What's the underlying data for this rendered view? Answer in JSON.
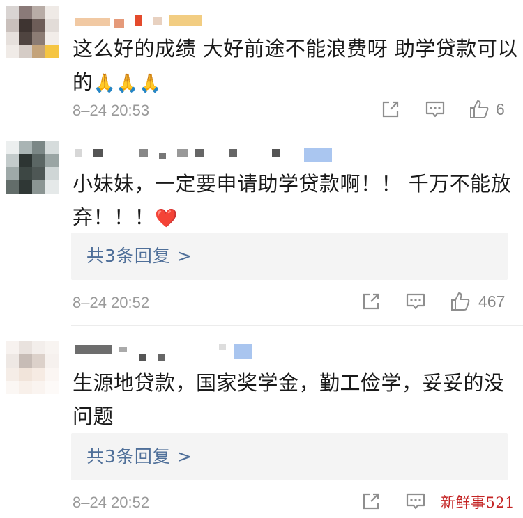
{
  "comments": [
    {
      "text": "这么好的成绩  大好前途不能浪费呀  助学贷款可以的",
      "emoji": "🙏🙏🙏",
      "timestamp": "8–24 20:53",
      "likes": "6",
      "icons": [
        "share-icon",
        "comment-icon",
        "like-icon"
      ]
    },
    {
      "text": "小妹妹，一定要申请助学贷款啊！！  千万不能放弃！！！",
      "emoji": "❤️",
      "replies_label": "共3条回复 >",
      "timestamp": "8–24 20:52",
      "likes": "467",
      "icons": [
        "share-icon",
        "comment-icon",
        "like-icon"
      ]
    },
    {
      "text": "生源地贷款，国家奖学金，勤工俭学，妥妥的没问题",
      "replies_label": "共3条回复 >",
      "timestamp": "8–24 20:52",
      "icons": [
        "share-icon",
        "comment-icon"
      ]
    }
  ],
  "watermark": "新鲜事521",
  "colors": {
    "reply_link": "#4f6f99",
    "meta_gray": "#9a9a9a",
    "reply_bg": "#f4f4f4",
    "watermark": "#c42424"
  }
}
